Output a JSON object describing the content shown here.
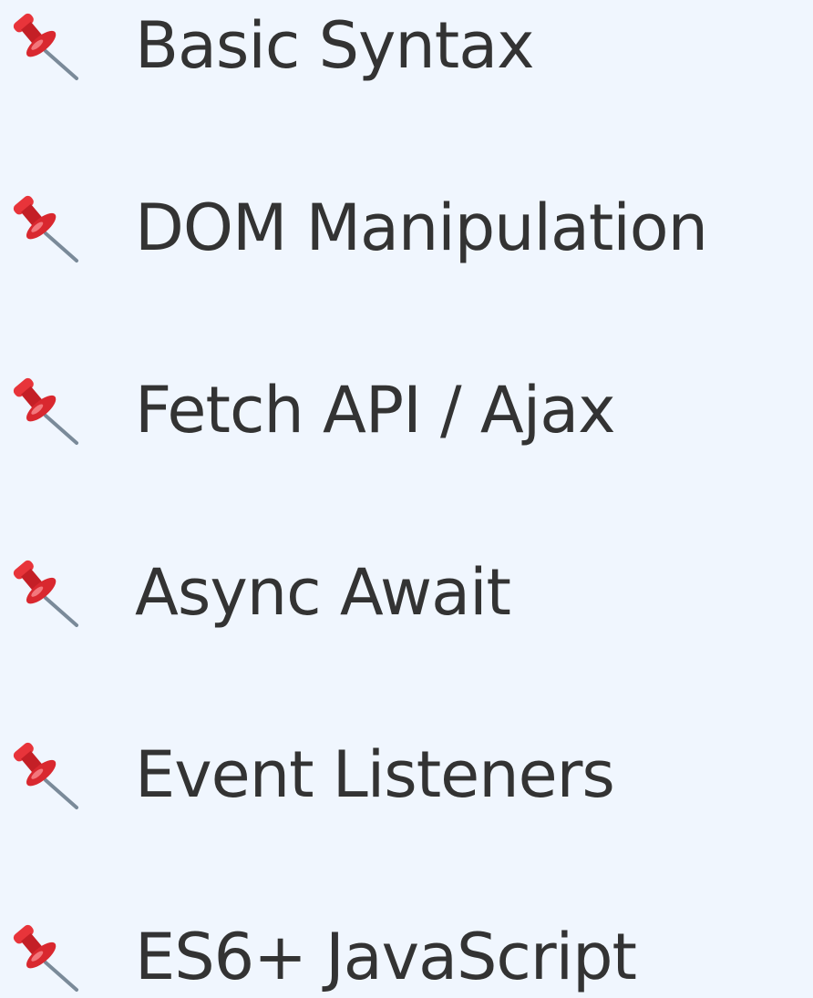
{
  "topics": {
    "items": [
      {
        "label": "Basic Syntax",
        "icon": "pushpin-icon"
      },
      {
        "label": "DOM Manipulation",
        "icon": "pushpin-icon"
      },
      {
        "label": "Fetch API / Ajax",
        "icon": "pushpin-icon"
      },
      {
        "label": "Async Await",
        "icon": "pushpin-icon"
      },
      {
        "label": "Event Listeners",
        "icon": "pushpin-icon"
      },
      {
        "label": "ES6+ JavaScript",
        "icon": "pushpin-icon"
      }
    ]
  },
  "colors": {
    "background": "#f0f6fe",
    "text": "#333333",
    "pin_red": "#d9282f",
    "pin_dark_red": "#9e1218",
    "needle": "#7a8a99"
  }
}
